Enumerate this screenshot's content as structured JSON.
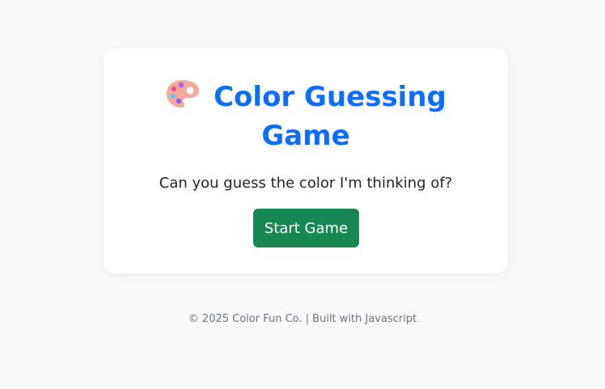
{
  "game": {
    "title_line1": "Color Guessing",
    "title_line2": "Game",
    "prompt": "Can you guess the color I'm thinking of?",
    "start_label": "Start Game",
    "title_icon": "palette-icon"
  },
  "footer": {
    "text": "© 2025 Color Fun Co. | Built with Javascript"
  },
  "colors": {
    "background": "#f8f9fa",
    "title": "#0d6efd",
    "button": "#198754",
    "footer_text": "#6c757d"
  }
}
